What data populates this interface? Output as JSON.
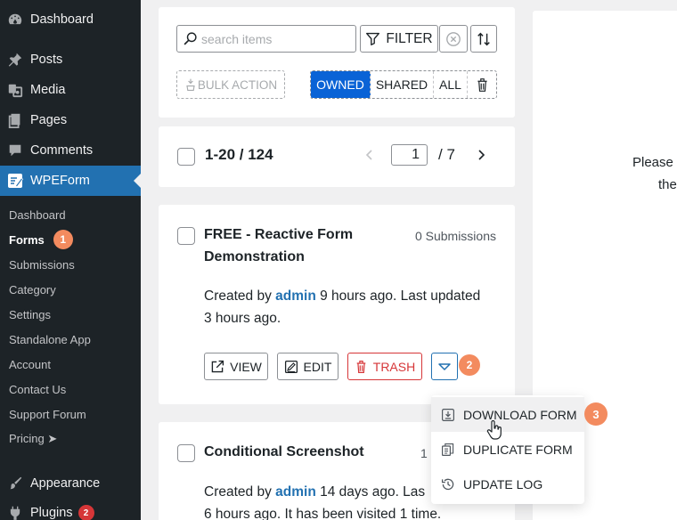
{
  "sidebar": {
    "top_items": [
      {
        "label": "Dashboard",
        "icon": "dashboard-icon"
      },
      {
        "label": "Posts",
        "icon": "pin-icon"
      },
      {
        "label": "Media",
        "icon": "media-icon"
      },
      {
        "label": "Pages",
        "icon": "pages-icon"
      },
      {
        "label": "Comments",
        "icon": "comment-icon"
      },
      {
        "label": "WPEForm",
        "icon": "form-icon"
      }
    ],
    "submenu": [
      "Dashboard",
      "Forms",
      "Submissions",
      "Category",
      "Settings",
      "Standalone App",
      "Account",
      "Contact Us",
      "Support Forum",
      "Pricing ➤"
    ],
    "bottom_items": [
      {
        "label": "Appearance",
        "icon": "brush-icon"
      },
      {
        "label": "Plugins",
        "icon": "plug-icon",
        "count": "2"
      }
    ]
  },
  "steps": [
    "1",
    "2",
    "3"
  ],
  "toolbar": {
    "search_placeholder": "search items",
    "filter_label": "FILTER",
    "bulk_action_label": "BULK ACTION",
    "tabs": [
      "OWNED",
      "SHARED",
      "ALL"
    ],
    "active_tab": "OWNED"
  },
  "pagination": {
    "range": "1-20 / 124",
    "current_page": "1",
    "total_pages": "/ 7"
  },
  "forms": [
    {
      "title_line1": "FREE - Reactive Form",
      "title_line2": "Demonstration",
      "submissions": "0 Submissions",
      "created_prefix": "Created by",
      "author": "admin",
      "created_suffix": "9 hours ago. Last updated",
      "created_line2": "3 hours ago."
    },
    {
      "title": "Conditional Screenshot",
      "submissions_partial": "1",
      "created_prefix": "Created by",
      "author": "admin",
      "created_suffix": "14 days ago. Las",
      "created_line2": "6 hours ago. It has been visited 1 time."
    }
  ],
  "actions": {
    "view": "VIEW",
    "edit": "EDIT",
    "trash": "TRASH"
  },
  "dropdown": [
    "DOWNLOAD FORM",
    "DUPLICATE FORM",
    "UPDATE LOG"
  ],
  "right_panel": {
    "line1": "Please",
    "line2": "the"
  },
  "colors": {
    "sidebar_bg": "#1d2327",
    "accent": "#2271b1",
    "tab_active": "#0a63d6",
    "step_badge": "#f38b5f",
    "trash": "#d63638"
  }
}
